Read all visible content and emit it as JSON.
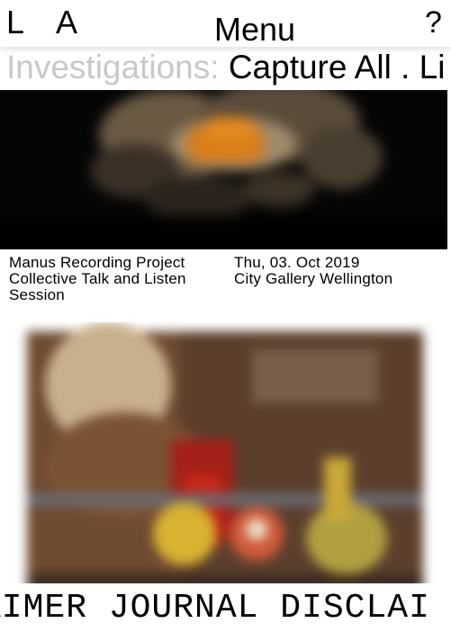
{
  "header": {
    "left_letter": "L",
    "second_letter": "A",
    "menu_label": "Menu",
    "help_label": "?"
  },
  "breadcrumb": {
    "prefix": "Investigations:",
    "current": "Capture All . Li"
  },
  "event": {
    "title_lines": [
      "Manus Recording Project",
      "Collective Talk and Listen",
      "Session"
    ],
    "date": "Thu, 03. Oct 2019",
    "venue": "City Gallery Wellington"
  },
  "footer": {
    "ticker": "AIMER JOURNAL DISCLAI"
  }
}
